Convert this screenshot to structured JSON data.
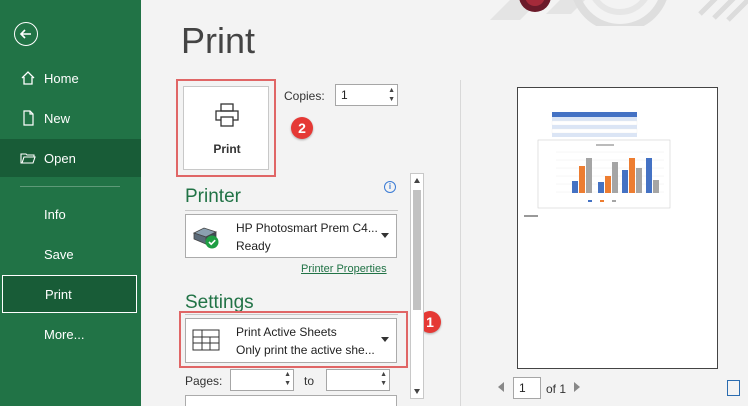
{
  "sidebar": {
    "items": [
      {
        "label": "Home"
      },
      {
        "label": "New"
      },
      {
        "label": "Open"
      },
      {
        "label": "Info"
      },
      {
        "label": "Save"
      },
      {
        "label": "Print"
      },
      {
        "label": "More..."
      }
    ]
  },
  "page_title": "Print",
  "print_button": {
    "label": "Print"
  },
  "copies": {
    "label": "Copies:",
    "value": "1"
  },
  "printer": {
    "heading": "Printer",
    "name": "HP Photosmart Prem C4...",
    "status": "Ready",
    "properties_link": "Printer Properties"
  },
  "settings": {
    "heading": "Settings",
    "option_title": "Print Active Sheets",
    "option_desc": "Only print the active she...",
    "pages_label": "Pages:",
    "to_label": "to"
  },
  "badges": {
    "first": "1",
    "second": "2"
  },
  "preview_nav": {
    "current_page": "1",
    "of_label": "of 1"
  },
  "colors": {
    "accent": "#217346",
    "highlight": "#e06666",
    "badge": "#e53935"
  }
}
